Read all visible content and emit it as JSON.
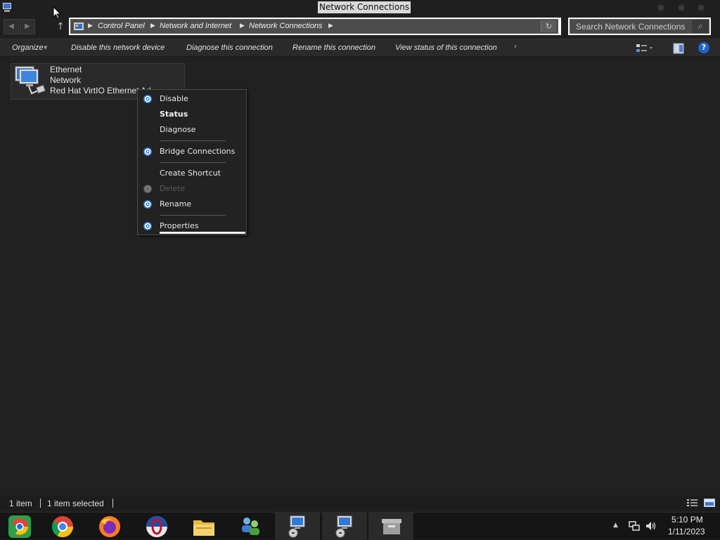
{
  "window": {
    "title": "Network Connections"
  },
  "address": {
    "crumbs": [
      "Control Panel",
      "Network and Internet",
      "Network Connections"
    ],
    "search_placeholder": "Search Network Connections"
  },
  "commands": {
    "organize": "Organize",
    "disable": "Disable this network device",
    "diagnose": "Diagnose this connection",
    "rename": "Rename this connection",
    "view_status": "View status of this connection"
  },
  "item": {
    "name": "Ethernet",
    "network": "Network",
    "adapter": "Red Hat VirtIO Ethernet Ad"
  },
  "context_menu": {
    "items": [
      {
        "label": "Disable",
        "icon": "shield-gear-icon"
      },
      {
        "label": "Status"
      },
      {
        "label": "Diagnose"
      },
      {
        "label": "Bridge Connections",
        "icon": "shield-gear-icon"
      },
      {
        "label": "Create Shortcut"
      },
      {
        "label": "Delete",
        "icon": "shield-gear-icon",
        "disabled": true
      },
      {
        "label": "Rename",
        "icon": "shield-gear-icon"
      },
      {
        "label": "Properties",
        "icon": "shield-gear-icon"
      }
    ]
  },
  "statusbar": {
    "count": "1 item",
    "selected": "1 item selected"
  },
  "taskbar": {
    "apps": [
      "chromium-icon",
      "chrome-icon",
      "firefox-icon",
      "opera-icon",
      "file-explorer-icon",
      "network-people-icon",
      "network-connections-icon",
      "network-connections-icon",
      "archive-icon"
    ],
    "time": "5:10 PM",
    "date": "1/11/2023"
  },
  "colors": {
    "background": "#202020",
    "accent": "#1c64c8"
  }
}
